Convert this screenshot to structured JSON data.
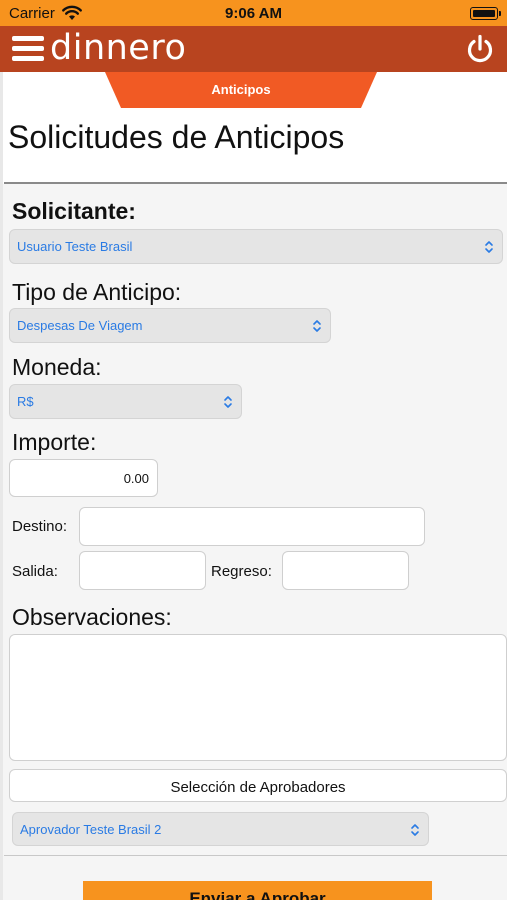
{
  "status_bar": {
    "carrier": "Carrier",
    "time": "9:06 AM"
  },
  "app_bar": {
    "logo": "dinnero"
  },
  "tab": {
    "label": "Anticipos"
  },
  "page": {
    "title": "Solicitudes de Anticipos"
  },
  "form": {
    "solicitante_label": "Solicitante:",
    "solicitante_value": "Usuario Teste Brasil",
    "tipo_label": "Tipo de Anticipo:",
    "tipo_value": "Despesas De Viagem",
    "moneda_label": "Moneda:",
    "moneda_value": "R$",
    "importe_label": "Importe:",
    "importe_value": "0.00",
    "destino_label": "Destino:",
    "destino_value": "",
    "salida_label": "Salida:",
    "salida_value": "",
    "regreso_label": "Regreso:",
    "regreso_value": "",
    "observaciones_label": "Observaciones:",
    "observaciones_value": ""
  },
  "approvers": {
    "button_label": "Selección de Aprobadores",
    "selected": "Aprovador Teste Brasil 2"
  },
  "send_button": {
    "label": "Enviar a Aprobar"
  },
  "colors": {
    "status_bar": "#f7931e",
    "app_bar": "#b8441f",
    "tab": "#f15a24",
    "link_blue": "#2a7be4"
  }
}
